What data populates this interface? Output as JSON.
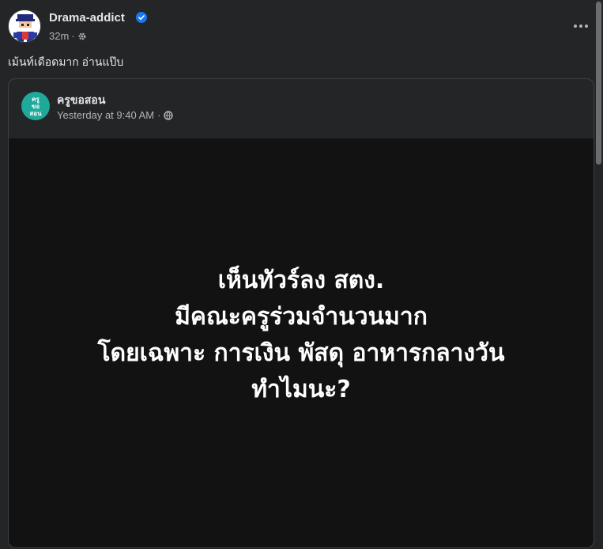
{
  "post": {
    "author": "Drama-addict",
    "time": "32m",
    "meta_separator": "·",
    "audience_icon": "gear-icon",
    "caption": "เม้นท์เดือดมาก อ่านแป๊บ"
  },
  "shared_post": {
    "author": "ครูขอสอน",
    "avatar_text": [
      "ครู",
      "ขอ",
      "สอน"
    ],
    "time": "Yesterday at 9:40 AM",
    "meta_separator": "·",
    "audience_icon": "globe-icon",
    "image_lines": [
      "เห็นทัวร์ลง สตง.",
      "มีคณะครูร่วมจำนวนมาก",
      "โดยเฉพาะ การเงิน พัสดุ อาหารกลางวัน",
      "ทำไมนะ?"
    ]
  },
  "colors": {
    "background": "#242526",
    "verified_badge": "#1877f2",
    "shared_avatar": "#1fa99a"
  }
}
